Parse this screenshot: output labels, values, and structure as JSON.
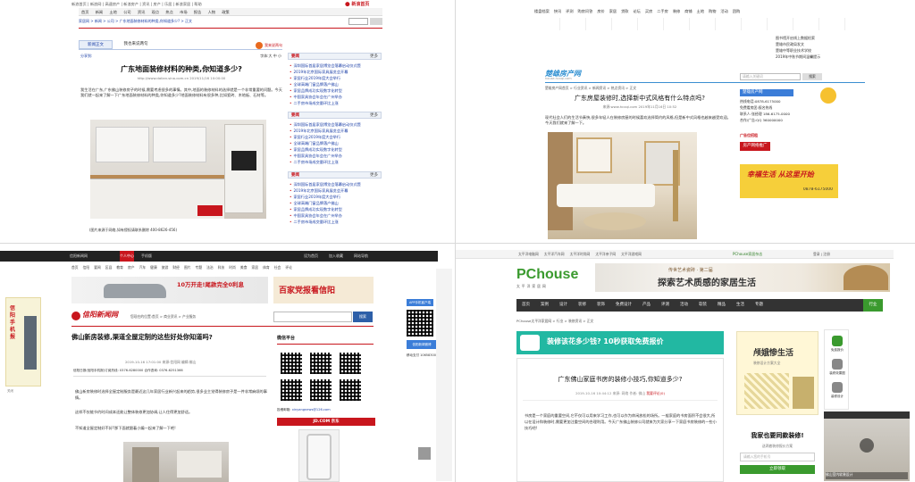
{
  "q1": {
    "topbar": "新浪首页 | 新浪网 | 高速房产 | 新浪房产 | 资讯 | 房产 | 乐居 | 新浪家居 | 帮助",
    "nav": [
      "首页",
      "新闻",
      "土地",
      "公司",
      "资讯",
      "观点",
      "热点",
      "市场",
      "报告",
      "人物",
      "政策"
    ],
    "breadcrumb": "家居网 > 新闻 > 公司 > 广东地面装修材料的种类,你知道多少? > 正文",
    "tabs": [
      "新闻正文",
      "我也来说两句"
    ],
    "share_label": "分享到:",
    "font_label": "字体:大 中 小",
    "title": "广东地面装修材料的种类,你知道多少?",
    "meta": "http://www.dalian.sina.com.cn   2019/11/16 10:00:00",
    "body": "我生活在广东,广东佛山装修房子的时候,需要考虑很多的事情。其中,地面的装修材料的选择就是一个非常重要的问题。今天我们就一起来了解一下广东地面装修材料的种类,你知道多少?地面装修材料有很多种,比如瓷砖、木地板、石材等。",
    "caption": "(图片来源于网络,如有侵权请联系删除 400-8626-456)",
    "sidebar_title": "要闻",
    "sidebar_more": "更多",
    "sidebar_items": [
      "深圳国际首届家居博览会落幕启动仪式暨",
      "2019年北京国际家具展览会开幕",
      "家居行业2019年度大会举行",
      "全球高端门窗品牌落户佛山",
      "家居品牌成功实现数字化转型",
      "中国家具协会年会在广州举办",
      "二手房市场成交量环比上涨"
    ]
  },
  "q2": {
    "nav_top": [
      "楼盘档案",
      "快讯",
      "评测",
      "购房问答",
      "房价",
      "家居",
      "贷款",
      "论坛",
      "买房",
      "二手房",
      "装修",
      "商铺",
      "土地",
      "购物",
      "活动",
      "团购"
    ],
    "logo": "楚雄房产网",
    "logo_sub": "house.hcxqi.com",
    "search_placeholder": "请输入关键词",
    "search_button": "搜索",
    "breadcrumb": "楚雄房产网首页 > 行业资讯 > 新闻资讯 > 热点资讯 > 正文",
    "right_links": [
      "图书馆开启线上数据检索",
      "楚雄市民政局发文",
      "楚雄中等职业技术学校",
      "2019年中秋节期间温馨提示"
    ],
    "title": "广东房屋装修时,选择新中式风格有什么特点吗?",
    "meta": "来源:www.hcxqi.com   2019年11月16日 10:52",
    "body": "现代社会人们的生活节奏快,很多年轻人在装修房屋的时候喜欢选择简约的风格,但是新中式风格也越来越受欢迎。今天我们就来了解一下。",
    "ad_title": "楚雄房产网",
    "ad_lines": [
      "热线电话:0878-6175000",
      "免费看房团:报名热线",
      "联系人:张经理 186-6175-0000",
      "合作/广告:QQ 360000000"
    ],
    "ad_red": "广告位招租",
    "ad_promo": "房产网络推广",
    "ad_box": "幸福生活 从这里开始",
    "ad_phone": "0878-6175000"
  },
  "q3": {
    "topbar": [
      "信阳新闻网",
      "个人中心",
      "手机版",
      "帮助",
      "设为首页",
      "加入收藏",
      "网站导航"
    ],
    "nav": [
      "首页",
      "信阳",
      "要闻",
      "区县",
      "教育",
      "房产",
      "汽车",
      "健康",
      "旅游",
      "财经",
      "图片",
      "专题",
      "法治",
      "科技",
      "时尚",
      "美食",
      "家居",
      "体育",
      "社会",
      "评论"
    ],
    "banner_car": "10万开走!尾款完全0利息",
    "banner_text": "百家党报看信阳",
    "site_logo": "信阳新闻网",
    "site_sub": "xinyang news",
    "breadcrumb": "您现在的位置:首页 > 商业资讯 > 产业服务",
    "search_button": "搜索",
    "title": "佛山新房装修,渠道全屋定制的这些好处你知道吗?",
    "meta": "2019-10-16 17:01:00   来源:信阳网   编辑:佛山",
    "notice": "信阳日报(信阳手机报)订阅热线: 0376-6280000 合作咨询: 0376-6251366",
    "body": [
      "佛山新房装修时选择全屋定制服务是最近这几年家居行业新兴起来的趋势,很多业主觉得装修房子是一件非常麻烦的事情。",
      "这样不仅能节约时间成本还能让整体装修更加协调,让人住得更加舒适。",
      "不知道全屋定制好不好?那下面就跟着小编一起来了解一下吧!"
    ],
    "sidebar_title": "微信平台",
    "app_badge": "APP手机客户端",
    "side_left": "信阳手机报",
    "close_label": "关闭",
    "email_label": "投稿邮箱",
    "email": "xinyangnews@126.com",
    "jd_label": "JD.COM 京东",
    "float_right": [
      "信阳新闻微博",
      "移动支付 10658300"
    ]
  },
  "q4": {
    "topbar": [
      "太平洋电脑网",
      "太平洋汽车网",
      "太平洋时尚网",
      "太平洋亲子网",
      "太平洋游戏网"
    ],
    "logo": "PChouse",
    "logo_sub": "太平洋家居网",
    "header_right": "PChouse家居杂志",
    "login_links": [
      "登录",
      "注册"
    ],
    "banner_title": "探索艺术质感的家居生活",
    "banner_tag": "传世艺术瓷砖 · 第二届",
    "nav": [
      "首页",
      "案例",
      "设计",
      "装修",
      "装饰",
      "免费设计",
      "产品",
      "评测",
      "活动",
      "软装",
      "精品",
      "生活",
      "专题",
      "行业"
    ],
    "breadcrumb": "PChouse太平洋家居网 > 行业 > 装修资讯 > 正文",
    "green_banner": "装修该花多少钱? 10秒获取免费报价",
    "title": "广东佛山家庭书房的装修小技巧,你知道多少?",
    "meta": "2019-10-16 10:44:12  来源: 网络  作者: 佛山  ",
    "meta_link": "我要评论(0)",
    "body": "书房是一个家庭的重要空间,它不仅可以用来学习工作,也可以作为休闲放松的场所。一般家庭的书房面积不会很大,所以在设计和装修时,需要更加注重空间的合理利用。今天广东佛山装修公司就来为大家分享一下家庭书房装修的一些小技巧吧!",
    "side_ad_title": "颅娥惨生活",
    "side_ad_sub": "装修设计方案大全",
    "promo_title": "我家也要同款装修!",
    "promo_sub": "送两套装修报价方案",
    "promo_input": "请输入您的手机号",
    "promo_button": "立即领取",
    "float_items": [
      "免费报价",
      "装修效果图",
      "装修设计"
    ],
    "video_caption": "佛山室内软装设计"
  }
}
